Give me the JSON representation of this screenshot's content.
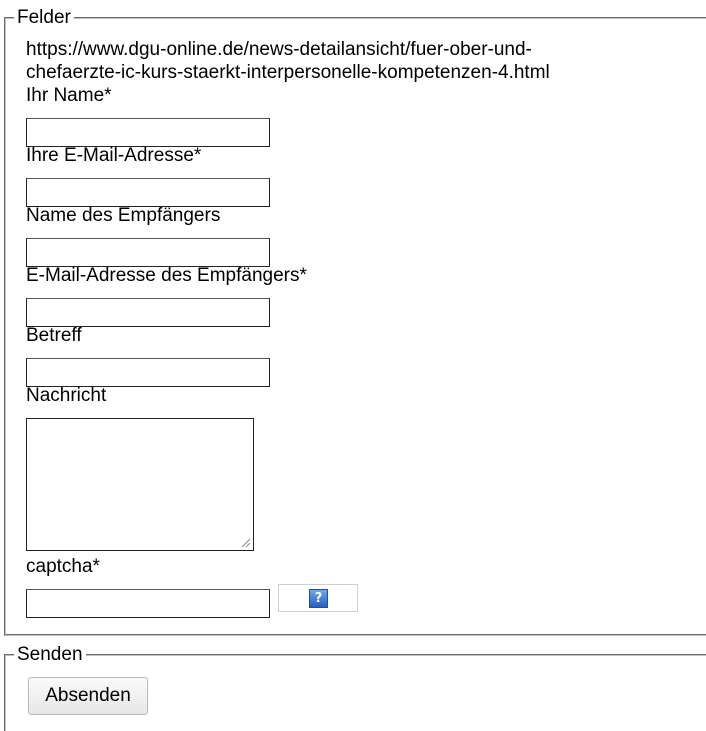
{
  "form": {
    "felder_legend": "Felder",
    "url_line1": "https://www.dgu-online.de/news-detailansicht/fuer-ober-und-",
    "url_line2": "chefaerzte-ic-kurs-staerkt-interpersonelle-kompetenzen-4.html",
    "fields": {
      "name_label": "Ihr Name*",
      "name_value": "",
      "email_label": "Ihre E-Mail-Adresse*",
      "email_value": "",
      "recipient_name_label": "Name des Empfängers",
      "recipient_name_value": "",
      "recipient_email_label": "E-Mail-Adresse des Empfängers*",
      "recipient_email_value": "",
      "subject_label": "Betreff",
      "subject_value": "",
      "message_label": "Nachricht",
      "message_value": "",
      "captcha_label": "captcha*",
      "captcha_value": ""
    },
    "captcha_help_glyph": "?",
    "captcha_help_icon": "help-icon",
    "senden_legend": "Senden",
    "submit_label": "Absenden"
  },
  "colors": {
    "help_icon_blue": "#2560c0",
    "input_border": "#222222",
    "fieldset_border": "#c0c0c0"
  }
}
